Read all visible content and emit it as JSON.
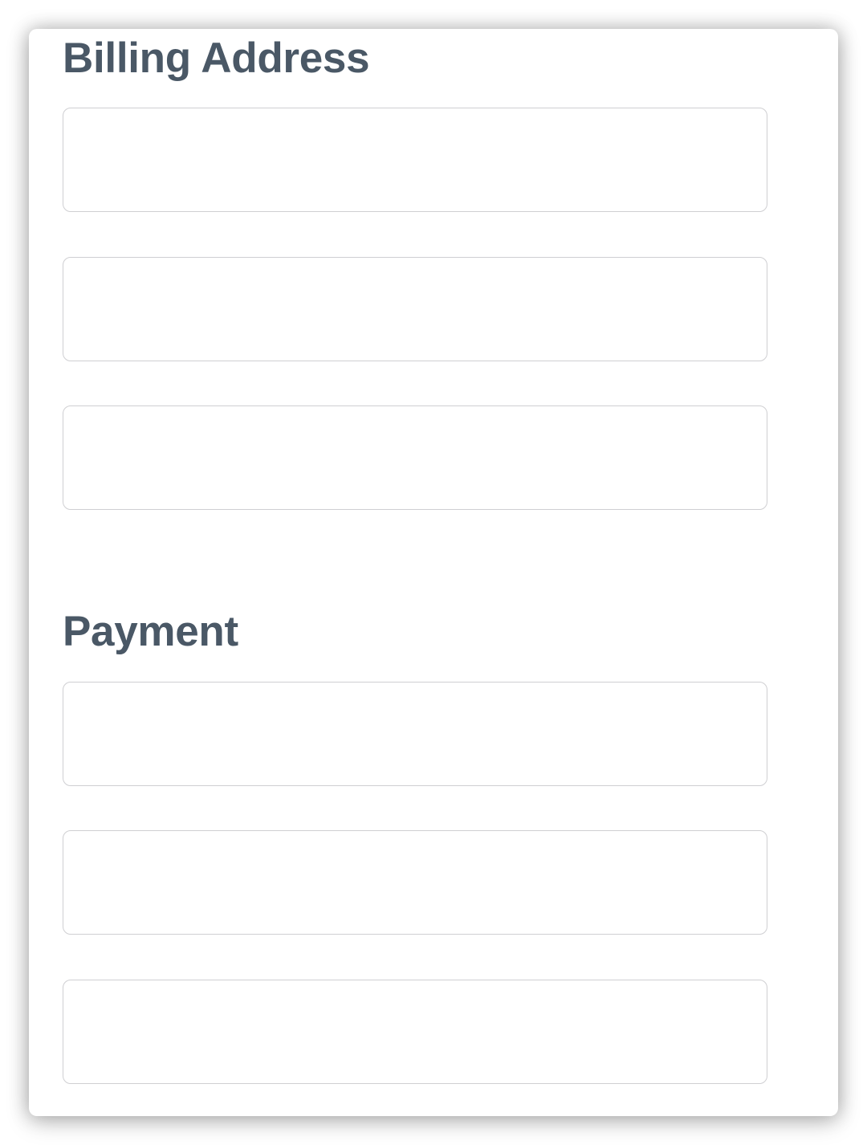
{
  "sections": {
    "billing": {
      "title": "Billing Address",
      "fields": [
        {
          "value": "",
          "placeholder": ""
        },
        {
          "value": "",
          "placeholder": ""
        },
        {
          "value": "",
          "placeholder": ""
        }
      ]
    },
    "payment": {
      "title": "Payment",
      "fields": [
        {
          "value": "",
          "placeholder": ""
        },
        {
          "value": "",
          "placeholder": ""
        },
        {
          "value": "",
          "placeholder": ""
        }
      ]
    }
  },
  "colors": {
    "heading": "#4a5866",
    "field_border": "#cfcfd2",
    "background": "#ffffff"
  }
}
